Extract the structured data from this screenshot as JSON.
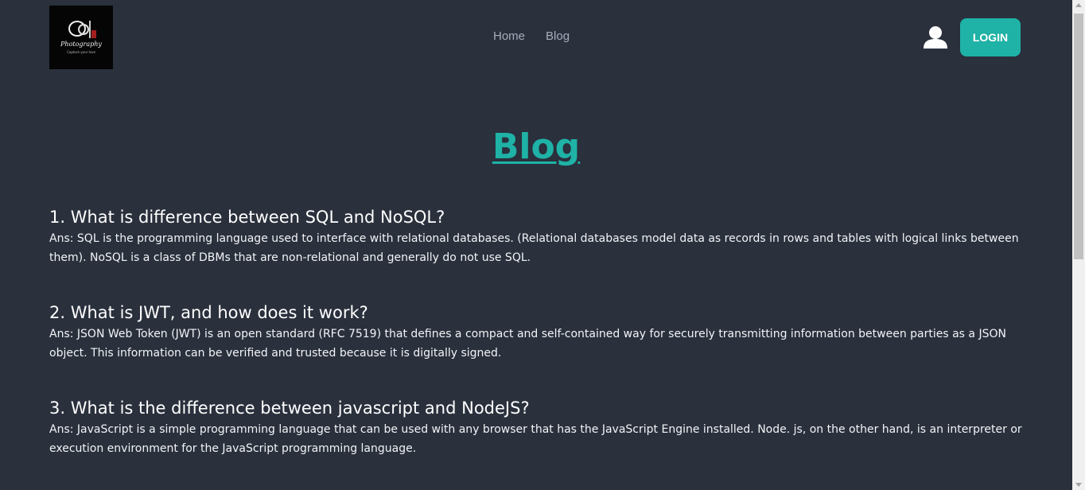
{
  "nav": {
    "logo_text": "Photography",
    "logo_tagline": "Capture your love",
    "links": [
      "Home",
      "Blog"
    ],
    "login_label": "LOGIN"
  },
  "main": {
    "title": "Blog",
    "questions": [
      {
        "question": "1. What is difference between SQL and NoSQL?",
        "answer": "Ans: SQL is the programming language used to interface with relational databases. (Relational databases model data as records in rows and tables with logical links between them). NoSQL is a class of DBMs that are non-relational and generally do not use SQL."
      },
      {
        "question": "2. What is JWT, and how does it work?",
        "answer": "Ans: JSON Web Token (JWT) is an open standard (RFC 7519) that defines a compact and self-contained way for securely transmitting information between parties as a JSON object. This information can be verified and trusted because it is digitally signed."
      },
      {
        "question": "3. What is the difference between javascript and NodeJS?",
        "answer": "Ans: JavaScript is a simple programming language that can be used with any browser that has the JavaScript Engine installed. Node. js, on the other hand, is an interpreter or execution environment for the JavaScript programming language."
      }
    ]
  },
  "colors": {
    "background": "#2a303c",
    "accent": "#1fb2a6",
    "nav_link": "#a6adbb"
  },
  "icons": {
    "user": "user-icon"
  }
}
